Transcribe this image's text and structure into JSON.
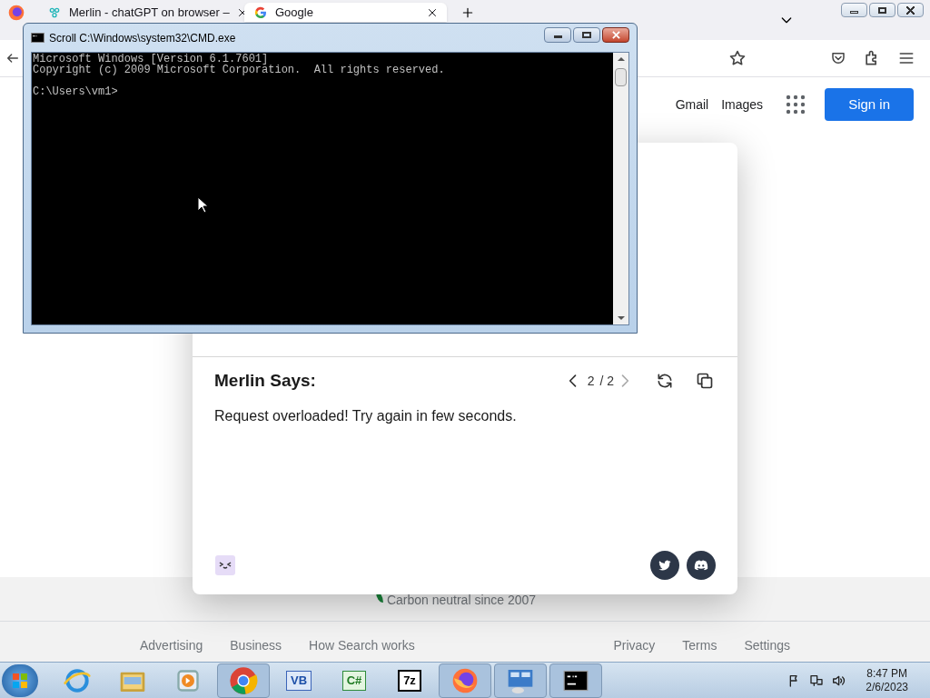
{
  "browser": {
    "tabs": [
      {
        "title": "Merlin - chatGPT on browser –",
        "selected": false
      },
      {
        "title": "Google",
        "selected": true
      }
    ],
    "header_links": [
      "Gmail",
      "Images"
    ],
    "sign_in": "Sign in",
    "carbon_note": "Carbon neutral since 2007",
    "footer_left": [
      "Advertising",
      "Business",
      "How Search works"
    ],
    "footer_right": [
      "Privacy",
      "Terms",
      "Settings"
    ]
  },
  "merlin": {
    "title": "Merlin Says:",
    "page": "2",
    "page_total": "/ 2",
    "message": "Request overloaded! Try again in few seconds."
  },
  "cmd": {
    "title": "Scroll C:\\Windows\\system32\\CMD.exe",
    "lines": [
      "Microsoft Windows [Version 6.1.7601]",
      "Copyright (c) 2009 Microsoft Corporation.  All rights reserved."
    ],
    "prompt": "C:\\Users\\vm1>"
  },
  "taskbar": {
    "apps": [
      {
        "kind": "ie",
        "running": false
      },
      {
        "kind": "explorer",
        "running": false
      },
      {
        "kind": "media",
        "running": false
      },
      {
        "kind": "chrome",
        "running": true
      },
      {
        "kind": "vb",
        "label": "VB",
        "running": false
      },
      {
        "kind": "csharp",
        "label": "C#",
        "running": false
      },
      {
        "kind": "zip",
        "label": "7z",
        "running": false
      },
      {
        "kind": "firefox",
        "running": true
      },
      {
        "kind": "control",
        "running": true
      },
      {
        "kind": "cmd",
        "running": true
      }
    ],
    "time": "8:47 PM",
    "date": "2/6/2023"
  }
}
